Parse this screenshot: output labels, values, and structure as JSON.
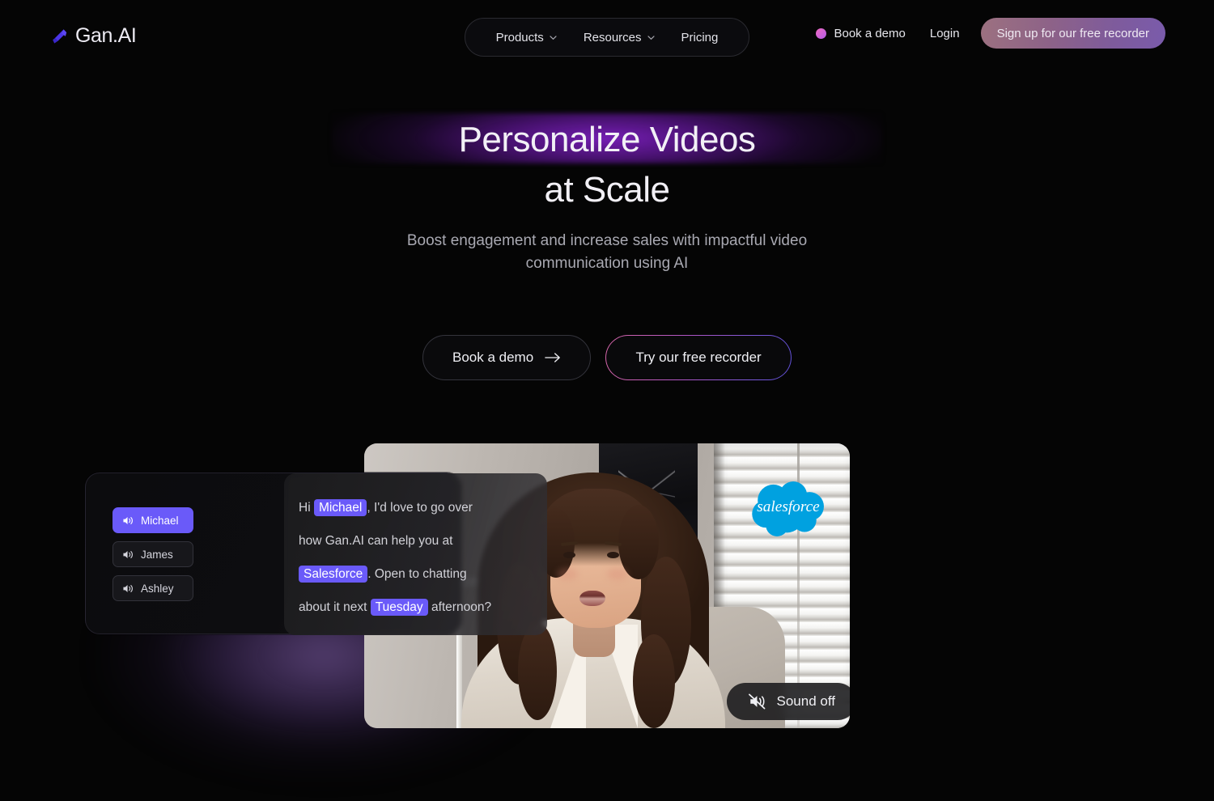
{
  "brand": {
    "name": "Gan.AI",
    "mark": "gan-logo-icon",
    "accent": "#4b35e8"
  },
  "nav": {
    "links": [
      {
        "label": "Products",
        "caret": true
      },
      {
        "label": "Resources",
        "caret": true
      },
      {
        "label": "Pricing",
        "caret": false
      }
    ],
    "demo_label": "Book a demo",
    "login_label": "Login",
    "signup_label": "Sign up for our free recorder",
    "dot_color": "#e06ac4"
  },
  "hero": {
    "headline_line1": "Personalize Videos",
    "headline_line2": "at Scale",
    "subhead_line1": "Boost engagement and increase sales with impactful video",
    "subhead_line2": "communication using AI",
    "glow_color": "#7c20be",
    "cta_primary": "Book a demo",
    "cta_secondary": "Try our free recorder"
  },
  "showcase": {
    "voices": [
      {
        "label": "Michael",
        "active": true
      },
      {
        "label": "James",
        "active": false
      },
      {
        "label": "Ashley",
        "active": false
      }
    ],
    "message": {
      "line1_pre": "Hi ",
      "line1_hl": "Michael",
      "line1_post": ", I'd love to go over",
      "line2": "how Gan.AI can help you at",
      "line3_hl": "Salesforce",
      "line3_post": ". Open to chatting",
      "line4_pre": "about it next ",
      "line4_hl": "Tuesday",
      "line4_post": " afternoon?"
    },
    "highlight_color": "#6a5af9",
    "badge_label": "salesforce",
    "badge_color": "#00a1e0",
    "sound_label": "Sound off"
  }
}
